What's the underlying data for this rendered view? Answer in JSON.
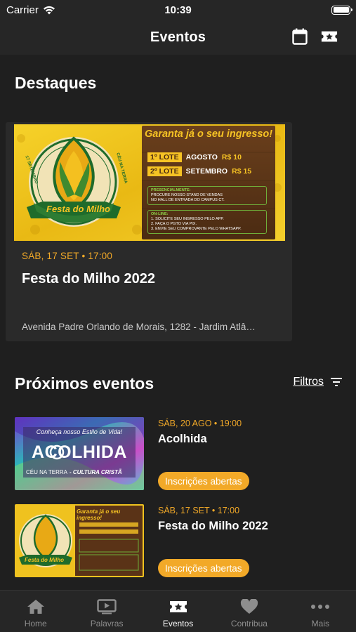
{
  "status": {
    "carrier": "Carrier",
    "time": "10:39"
  },
  "nav": {
    "title": "Eventos",
    "calendar_icon": "calendar-icon",
    "ticket_icon": "ticket-icon"
  },
  "highlights": {
    "title": "Destaques",
    "card": {
      "date": "SÁB, 17 SET • 17:00",
      "title": "Festa do Milho 2022",
      "address": "Avenida Padre Orlando de Morais, 1282 - Jardim Atlâ…",
      "banner": {
        "headline": "Garanta já o seu ingresso!",
        "lot1_label": "1º LOTE",
        "lot1_text": "AGOSTO",
        "lot1_price": "R$ 10",
        "lot2_label": "2º LOTE",
        "lot2_text": "SETEMBRO",
        "lot2_price": "R$ 15",
        "presencial_title": "PRESENCIALMENTE:",
        "presencial_line1": "PROCURE NOSSO STAND DE VENDAS",
        "presencial_line2": "NO HALL DE ENTRADA DO CAMPUS CT.",
        "online_title": "ON-LINE:",
        "online_line1": "1. SOLICITE SEU INGRESSO PELO APP.",
        "online_line2": "2. FAÇA O PGTO VIA PIX.",
        "online_line3": "3. ENVIE SEU COMPROVANTE PELO WHATSAPP.",
        "logo_text": "Festa do Milho",
        "seal_left": "17 SETEMBRO",
        "seal_right": "CÉU NA TERRA"
      }
    }
  },
  "upcoming": {
    "title": "Próximos eventos",
    "filters_label": "Filtros",
    "items": [
      {
        "date": "SÁB, 20 AGO • 19:00",
        "name": "Acolhida",
        "badge": "Inscrições abertas",
        "thumb_top": "Conheça nosso Estilo de Vida!",
        "thumb_title": "ACOLHIDA",
        "thumb_bottom_left": "CÉU NA TERRA",
        "thumb_bottom_right": "- CULTURA CRISTÃ"
      },
      {
        "date": "SÁB, 17 SET • 17:00",
        "name": "Festa do Milho 2022",
        "badge": "Inscrições abertas",
        "thumb_headline": "Garanta já o seu ingresso!",
        "thumb_logo": "Festa do Milho"
      }
    ]
  },
  "tabs": [
    {
      "label": "Home",
      "icon": "home-icon"
    },
    {
      "label": "Palavras",
      "icon": "video-icon"
    },
    {
      "label": "Eventos",
      "icon": "ticket-icon",
      "active": true
    },
    {
      "label": "Contribua",
      "icon": "heart-icon"
    },
    {
      "label": "Mais",
      "icon": "more-icon"
    }
  ],
  "colors": {
    "accent": "#f2a928",
    "background": "#1f1f1f",
    "bar": "#262626"
  }
}
